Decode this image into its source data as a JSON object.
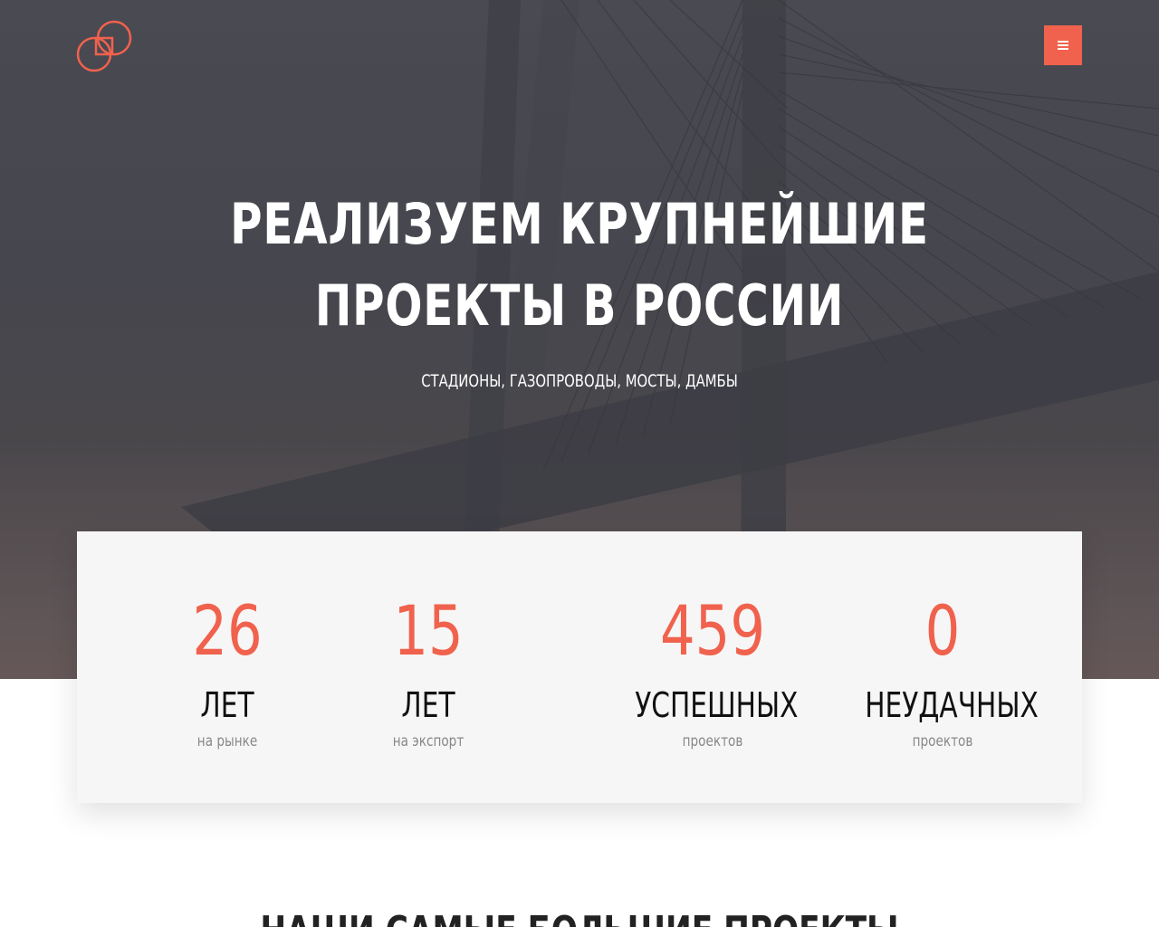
{
  "header": {
    "logo_icon": "interlocked-rings-logo-icon",
    "menu_icon": "hamburger-menu-icon",
    "accent_color": "#f0624d"
  },
  "hero": {
    "title_line1": "РЕАЛИЗУЕМ КРУПНЕЙШИЕ",
    "title_line2": "ПРОЕКТЫ В РОССИИ",
    "subtitle": "СТАДИОНЫ, ГАЗОПРОВОДЫ, МОСТЫ, ДАМБЫ"
  },
  "stats": [
    {
      "number": "26",
      "unit": "ЛЕТ",
      "caption": "на рынке"
    },
    {
      "number": "15",
      "unit": "ЛЕТ",
      "caption": "на экспорт"
    },
    {
      "number": "459",
      "unit": "УСПЕШНЫХ",
      "caption": "проектов"
    },
    {
      "number": "0",
      "unit": "НЕУДАЧНЫХ",
      "caption": "проектов"
    }
  ],
  "projects_section": {
    "title": "НАШИ САМЫЕ БОЛЬШИЕ ПРОЕКТЫ"
  }
}
